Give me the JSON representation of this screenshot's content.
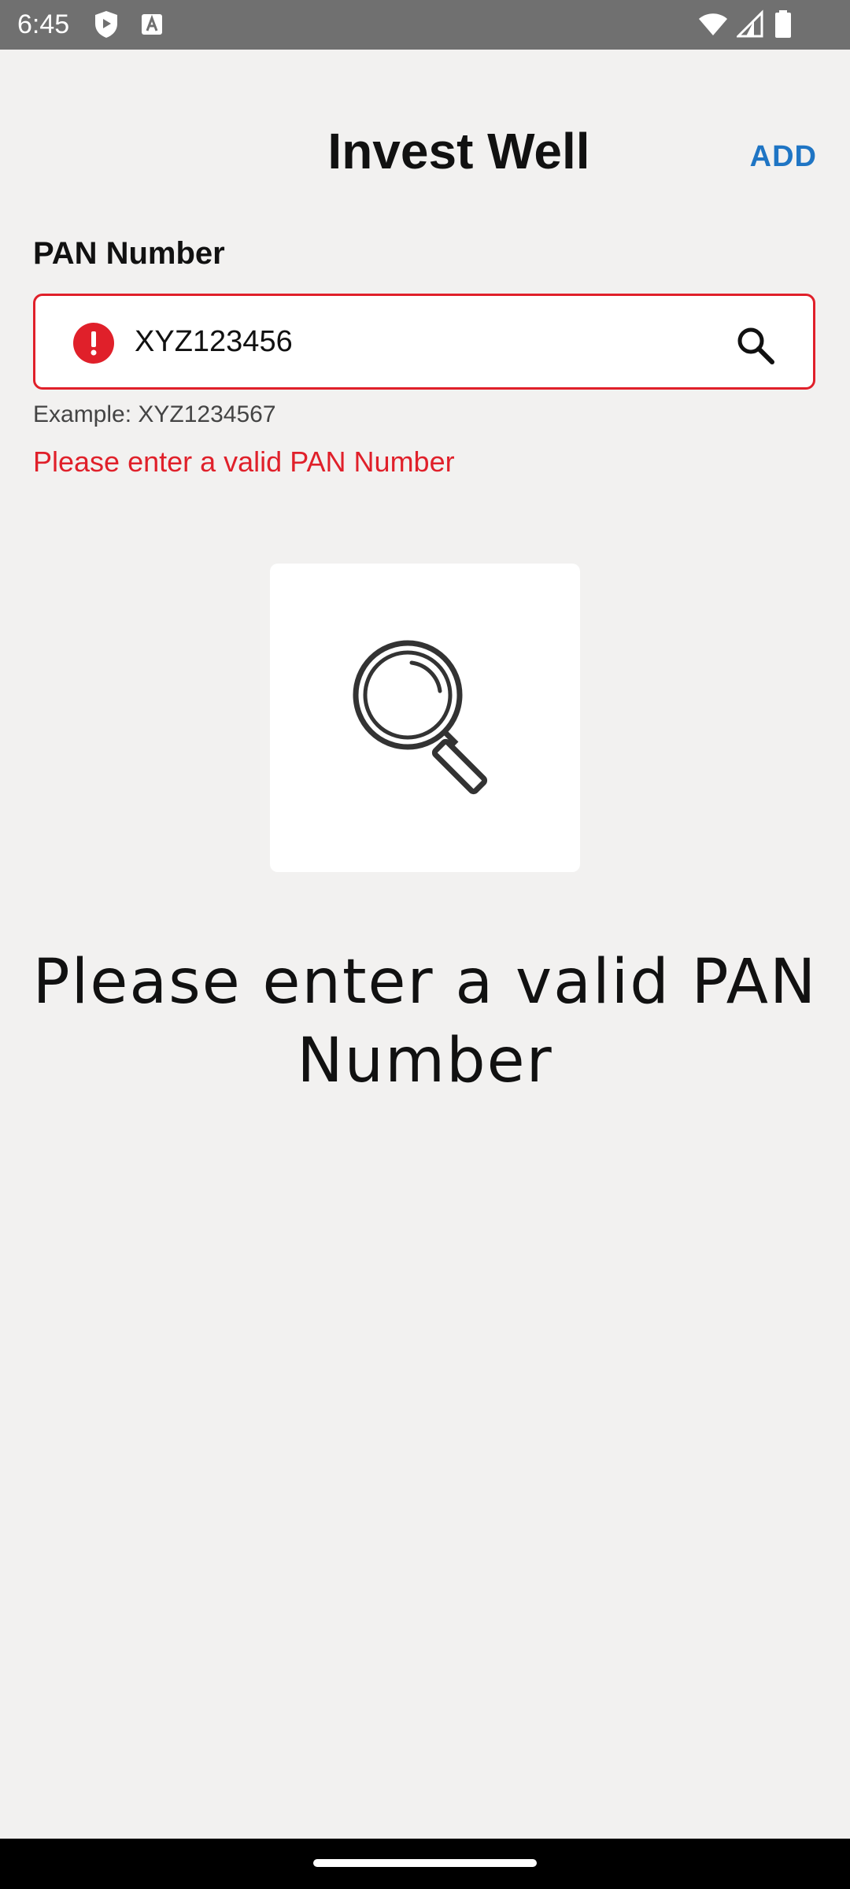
{
  "status_bar": {
    "time": "6:45",
    "icons": [
      "shield-play-icon",
      "font-a-icon",
      "wifi-icon",
      "cell-signal-icon",
      "battery-icon"
    ]
  },
  "header": {
    "title": "Invest Well",
    "add_label": "ADD"
  },
  "pan_field": {
    "label": "PAN Number",
    "value": "XYZ123456",
    "hint": "Example: XYZ1234567",
    "error": "Please enter a valid PAN Number",
    "error_color": "#e0202a"
  },
  "empty_state": {
    "icon": "magnifier-icon",
    "message": "Please enter a valid PAN Number"
  },
  "colors": {
    "accent": "#1f75c4",
    "error": "#e0202a",
    "background": "#f2f1f0"
  }
}
